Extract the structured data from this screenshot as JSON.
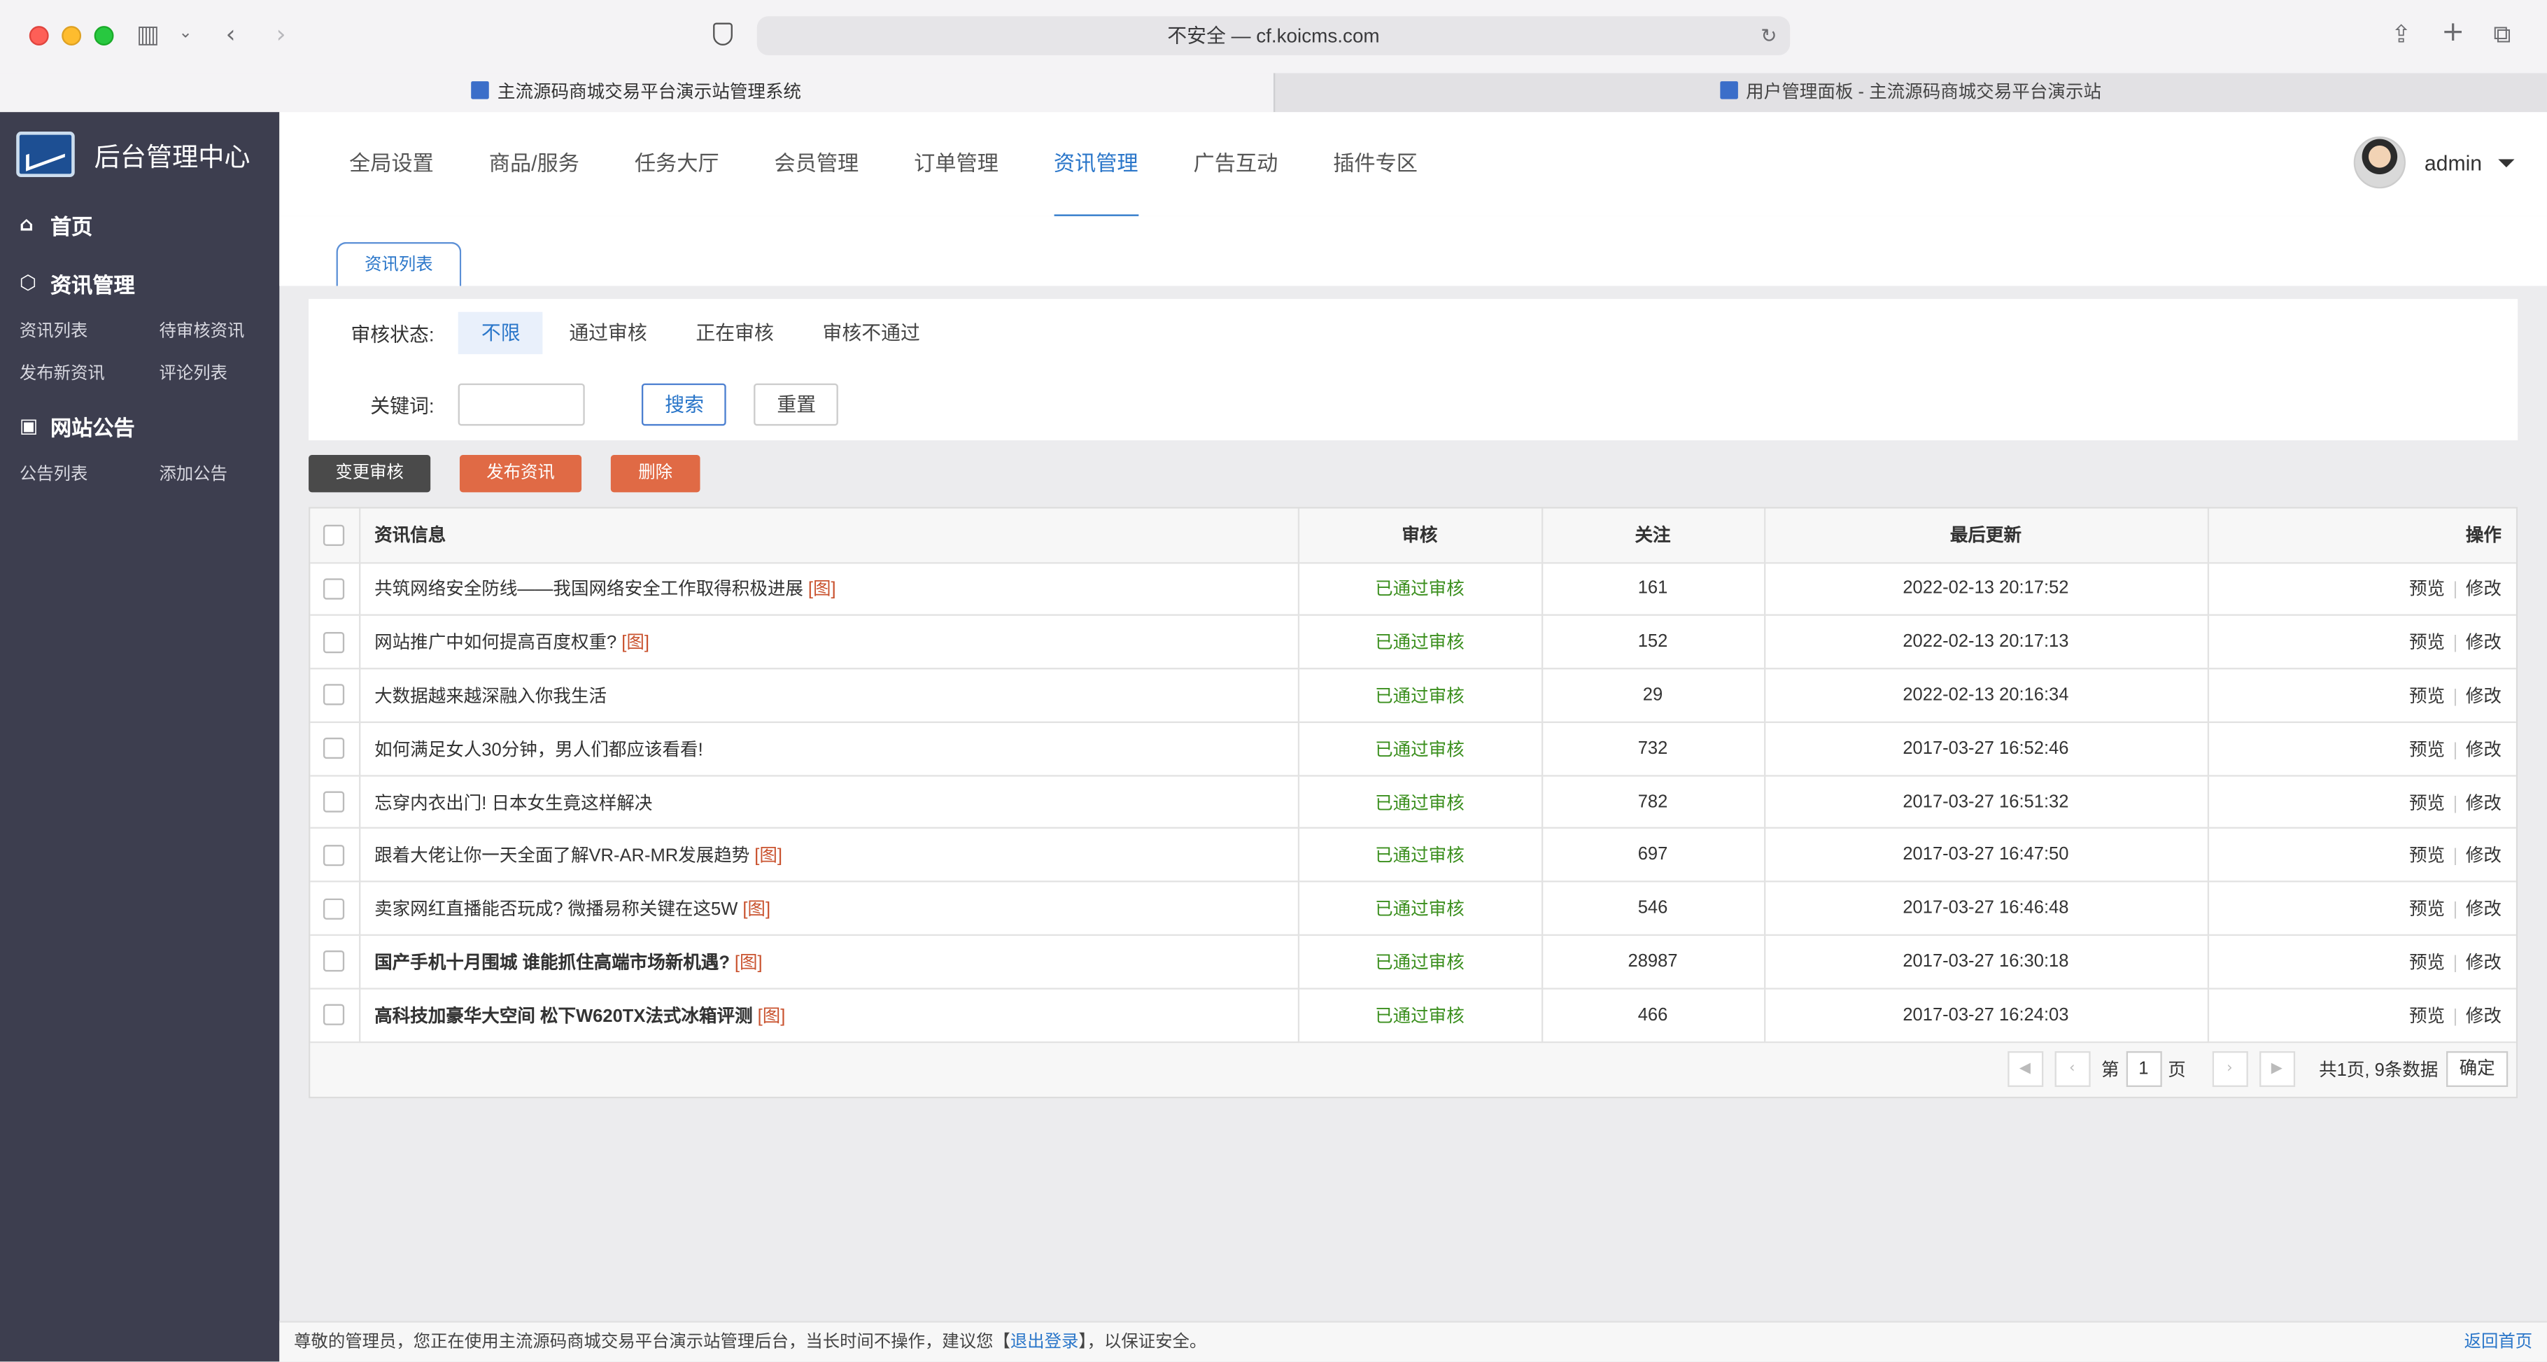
{
  "browser": {
    "url": "不安全 — cf.koicms.com",
    "tabs": [
      "主流源码商城交易平台演示站管理系统",
      "用户管理面板 - 主流源码商城交易平台演示站"
    ]
  },
  "sidebar": {
    "brand": "后台管理中心",
    "home": "首页",
    "groups": [
      {
        "title": "资讯管理",
        "items": [
          "资讯列表",
          "待审核资讯",
          "发布新资讯",
          "评论列表"
        ]
      },
      {
        "title": "网站公告",
        "items": [
          "公告列表",
          "添加公告"
        ]
      }
    ]
  },
  "topnav": {
    "items": [
      "全局设置",
      "商品/服务",
      "任务大厅",
      "会员管理",
      "订单管理",
      "资讯管理",
      "广告互动",
      "插件专区"
    ],
    "active_index": 5,
    "user": "admin"
  },
  "subtab": "资讯列表",
  "filter": {
    "status_label": "审核状态:",
    "status_options": [
      "不限",
      "通过审核",
      "正在审核",
      "审核不通过"
    ],
    "keyword_label": "关键词:",
    "keyword_value": "",
    "search_btn": "搜索",
    "reset_btn": "重置"
  },
  "actions": {
    "change_review": "变更审核",
    "publish": "发布资讯",
    "delete": "删除"
  },
  "colors": {
    "dark_btn": "#4a4a4a",
    "orange_btn": "#e06a45",
    "accent": "#2a76c9",
    "sidebar": "#3d3e4f",
    "approved": "#3b8f1e"
  },
  "table": {
    "headers": [
      "资讯信息",
      "审核",
      "关注",
      "最后更新",
      "操作"
    ],
    "rows": [
      {
        "title": "共筑网络安全防线——我国网络安全工作取得积极进展",
        "img": "[图]",
        "bold": false,
        "status": "已通过审核",
        "follows": "161",
        "updated": "2022-02-13 20:17:52"
      },
      {
        "title": "网站推广中如何提高百度权重?",
        "img": "[图]",
        "bold": false,
        "status": "已通过审核",
        "follows": "152",
        "updated": "2022-02-13 20:17:13"
      },
      {
        "title": "大数据越来越深融入你我生活",
        "img": "",
        "bold": false,
        "status": "已通过审核",
        "follows": "29",
        "updated": "2022-02-13 20:16:34"
      },
      {
        "title": "如何满足女人30分钟，男人们都应该看看!",
        "img": "",
        "bold": false,
        "status": "已通过审核",
        "follows": "732",
        "updated": "2017-03-27 16:52:46"
      },
      {
        "title": "忘穿内衣出门! 日本女生竟这样解决",
        "img": "",
        "bold": false,
        "status": "已通过审核",
        "follows": "782",
        "updated": "2017-03-27 16:51:32"
      },
      {
        "title": "跟着大佬让你一天全面了解VR-AR-MR发展趋势",
        "img": "[图]",
        "bold": false,
        "status": "已通过审核",
        "follows": "697",
        "updated": "2017-03-27 16:47:50"
      },
      {
        "title": "卖家网红直播能否玩成? 微播易称关键在这5W",
        "img": "[图]",
        "bold": false,
        "status": "已通过审核",
        "follows": "546",
        "updated": "2017-03-27 16:46:48"
      },
      {
        "title": "国产手机十月围城 谁能抓住高端市场新机遇?",
        "img": "[图]",
        "bold": true,
        "status": "已通过审核",
        "follows": "28987",
        "updated": "2017-03-27 16:30:18"
      },
      {
        "title": "高科技加豪华大空间 松下W620TX法式冰箱评测",
        "img": "[图]",
        "bold": true,
        "status": "已通过审核",
        "follows": "466",
        "updated": "2017-03-27 16:24:03"
      }
    ],
    "op_preview": "预览",
    "op_edit": "修改",
    "op_sep": "|"
  },
  "pager": {
    "page_prefix": "第",
    "page_value": "1",
    "page_suffix": "页",
    "summary": "共1页, 9条数据",
    "confirm": "确定"
  },
  "footer": {
    "prefix": "尊敬的管理员，您正在使用主流源码商城交易平台演示站管理后台，当长时间不操作，建议您【",
    "logout": "退出登录",
    "suffix": "】，以保证安全。",
    "back": "返回首页"
  }
}
